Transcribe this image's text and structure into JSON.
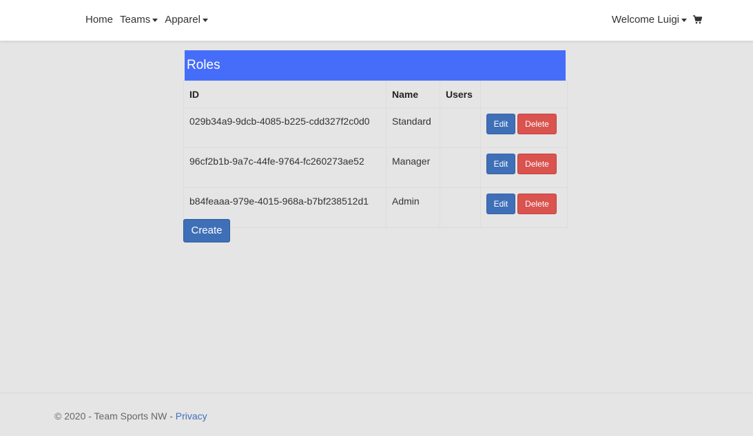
{
  "nav": {
    "home": "Home",
    "teams": "Teams",
    "apparel": "Apparel",
    "welcome": "Welcome Luigi"
  },
  "panel": {
    "title": "Roles"
  },
  "table": {
    "headers": [
      "ID",
      "Name",
      "Users",
      ""
    ],
    "rows": [
      {
        "id": "029b34a9-9dcb-4085-b225-cdd327f2c0d0",
        "name": "Standard",
        "users": ""
      },
      {
        "id": "96cf2b1b-9a7c-44fe-9764-fc260273ae52",
        "name": "Manager",
        "users": ""
      },
      {
        "id": "b84feaaa-979e-4015-968a-b7bf238512d1",
        "name": "Admin",
        "users": ""
      }
    ],
    "edit_label": "Edit",
    "delete_label": "Delete"
  },
  "create_label": "Create",
  "footer": {
    "text": "© 2020 - Team Sports NW - ",
    "privacy": "Privacy"
  },
  "colors": {
    "header_blue": "#456df9",
    "edit_blue": "#3f6fb7",
    "delete_red": "#d9534f"
  },
  "icons": {
    "cart": "shopping-cart-icon",
    "dropdown": "caret-down-icon"
  }
}
